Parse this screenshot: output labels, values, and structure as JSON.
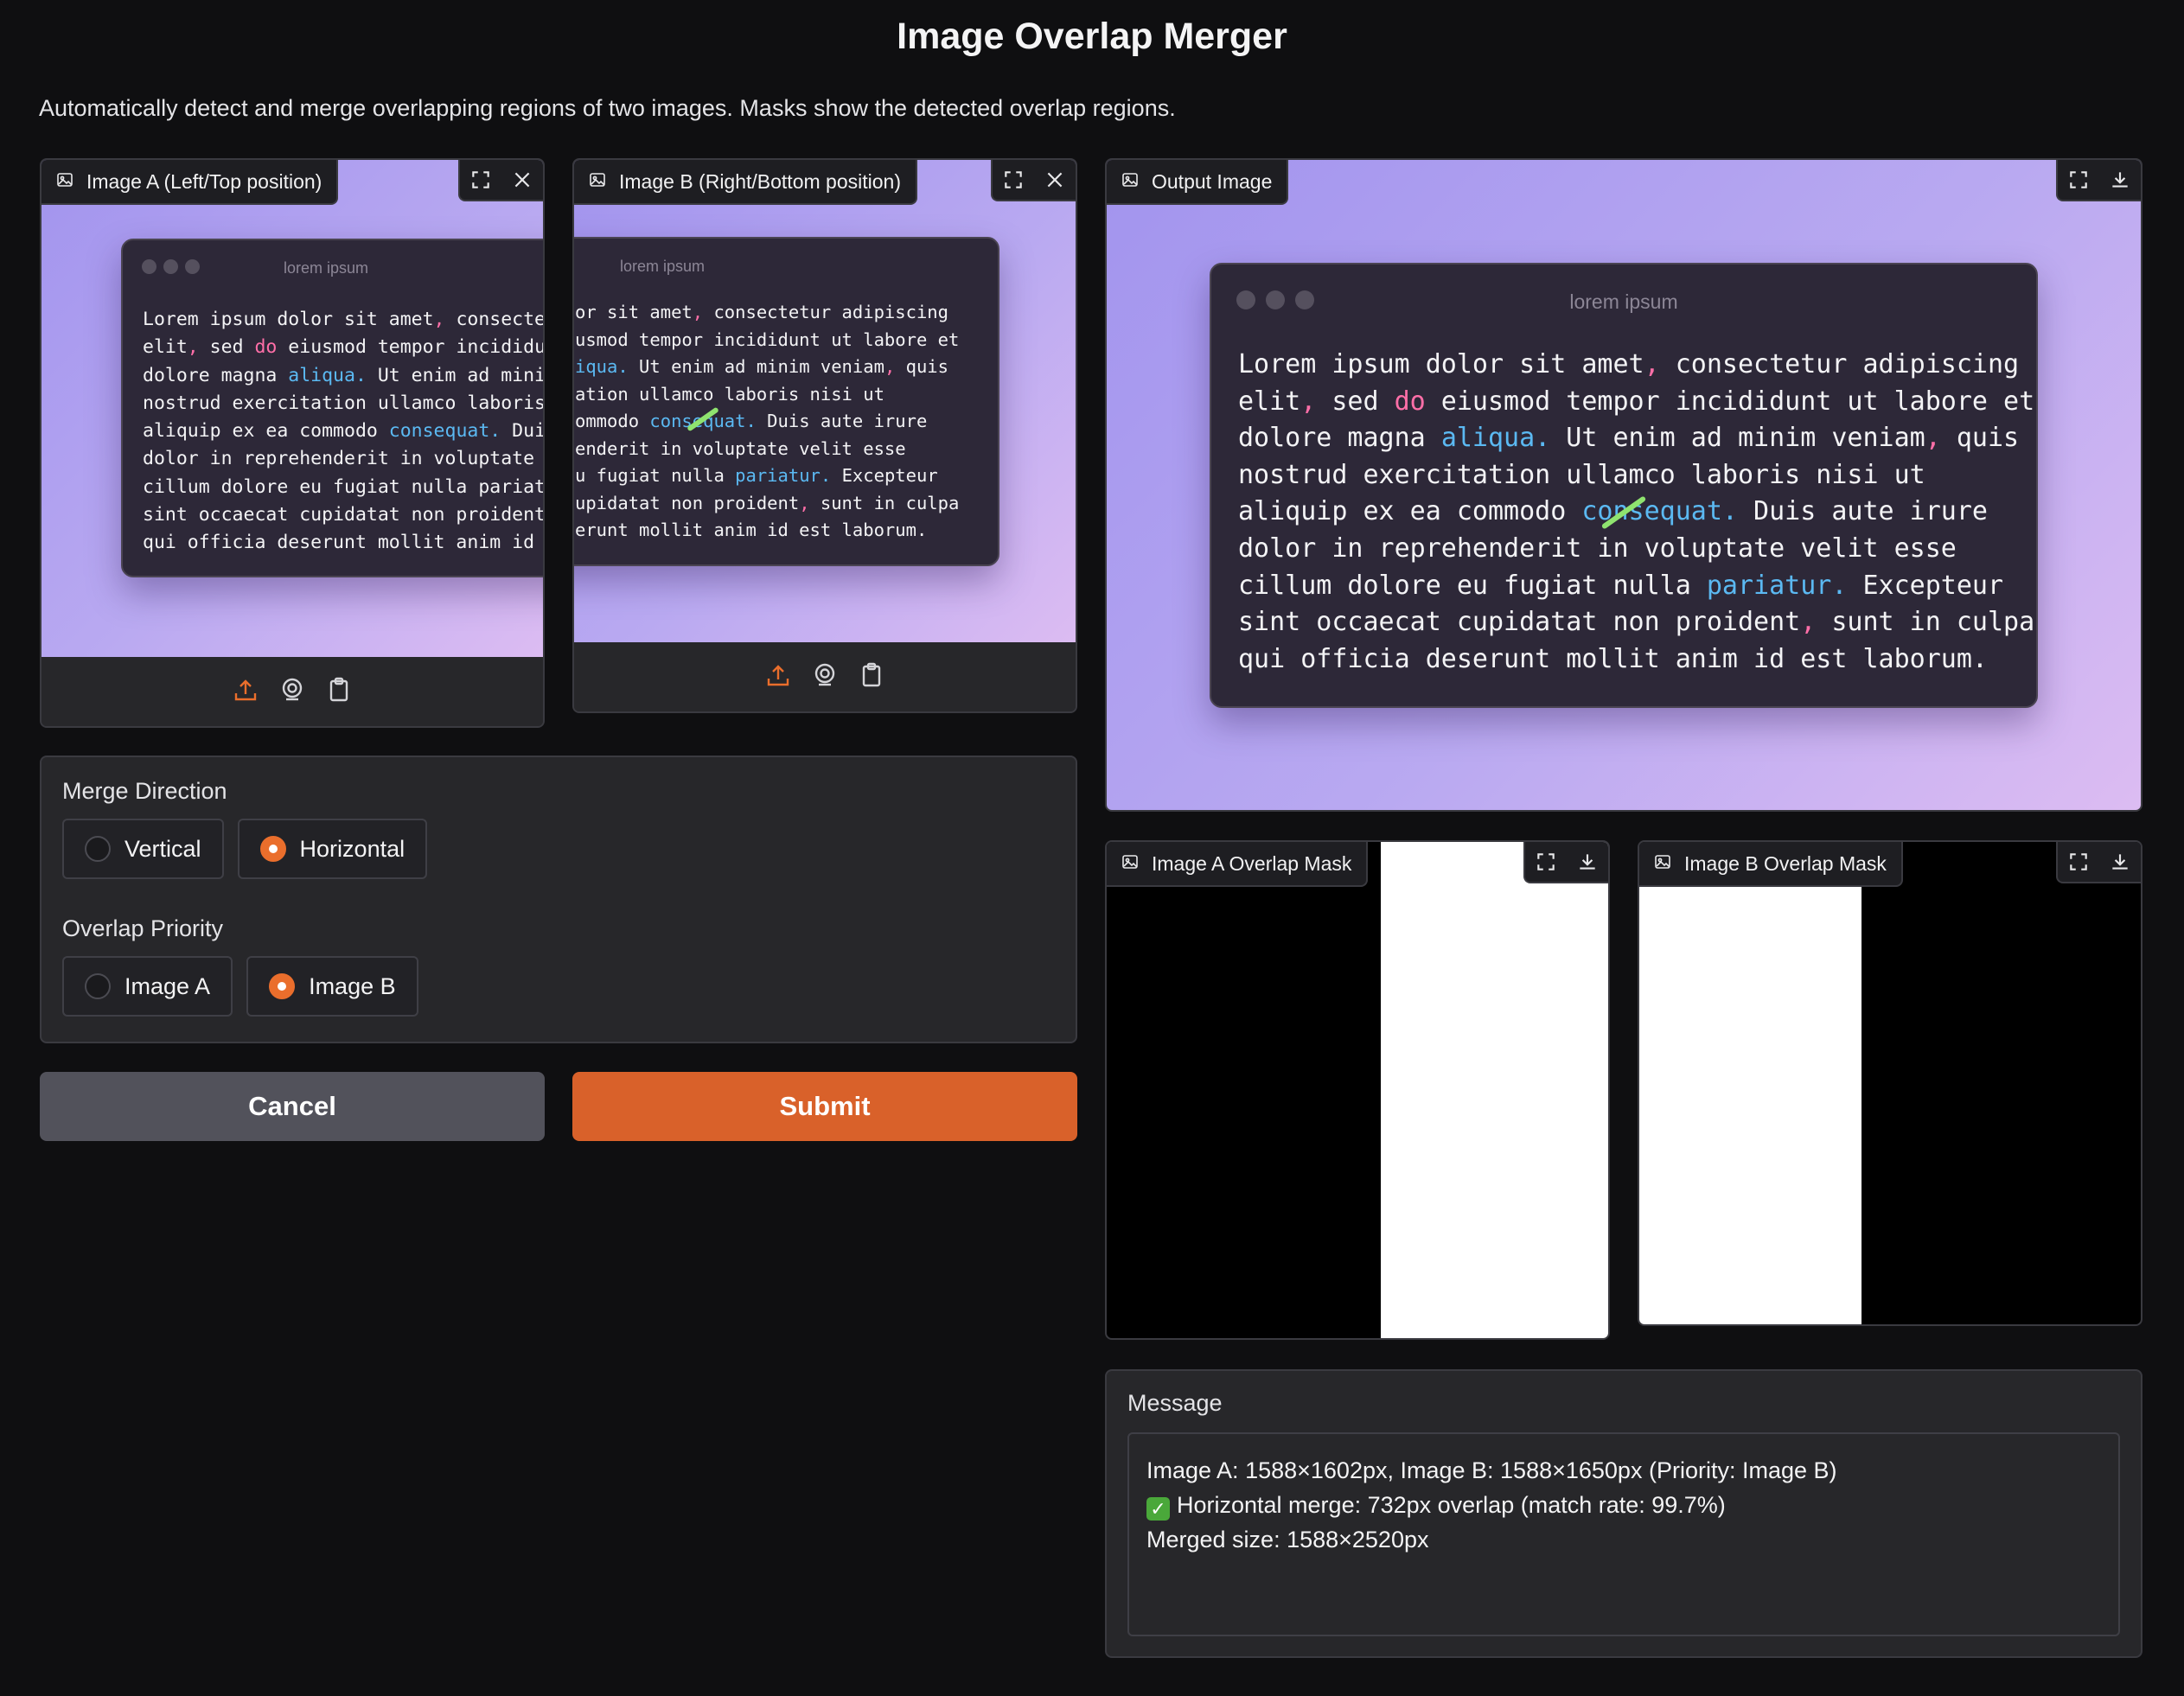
{
  "app": {
    "title": "Image Overlap Merger",
    "description": "Automatically detect and merge overlapping regions of two images. Masks show the detected overlap regions."
  },
  "image_a": {
    "label": "Image A (Left/Top position)"
  },
  "image_b": {
    "label": "Image B (Right/Bottom position)"
  },
  "output": {
    "label": "Output Image"
  },
  "mask_a": {
    "label": "Image A Overlap Mask",
    "white_fraction_start": 0.545
  },
  "mask_b": {
    "label": "Image B Overlap Mask",
    "white_fraction_end": 0.44
  },
  "sample_window": {
    "title": "lorem ipsum",
    "lines": [
      "Lorem ipsum dolor sit amet, consectetur adipiscing",
      "elit, sed do eiusmod tempor incididunt ut labore et",
      "dolore magna aliqua. Ut enim ad minim veniam, quis",
      "nostrud exercitation ullamco laboris nisi ut",
      "aliquip ex ea commodo consequat. Duis aute irure",
      "dolor in reprehenderit in voluptate velit esse",
      "cillum dolore eu fugiat nulla pariatur. Excepteur",
      "sint occaecat cupidatat non proident, sunt in culpa",
      "qui officia deserunt mollit anim id est laborum."
    ],
    "crop_a_lines": [
      "Lorem ipsum dolor sit amet, consecte",
      "elit, sed do eiusmod tempor incididu",
      "dolore magna aliqua. Ut enim ad mini",
      "nostrud exercitation ullamco laboris",
      "aliquip ex ea commodo consequat. Dui",
      "dolor in reprehenderit in voluptate ",
      "cillum dolore eu fugiat nulla pariat",
      "sint occaecat cupidatat non proident",
      "qui officia deserunt mollit anim id "
    ],
    "crop_b_lines": [
      "or sit amet, consectetur adipiscing",
      "usmod tempor incididunt ut labore et",
      "iqua. Ut enim ad minim veniam, quis",
      "ation ullamco laboris nisi ut",
      "ommodo consequat. Duis aute irure",
      "enderit in voluptate velit esse",
      "u fugiat nulla pariatur. Excepteur",
      "upidatat non proident, sunt in culpa",
      "erunt mollit anim id est laborum."
    ]
  },
  "merge_direction": {
    "label": "Merge Direction",
    "options": [
      "Vertical",
      "Horizontal"
    ],
    "selected": "Horizontal"
  },
  "overlap_priority": {
    "label": "Overlap Priority",
    "options": [
      "Image A",
      "Image B"
    ],
    "selected": "Image B"
  },
  "buttons": {
    "cancel": "Cancel",
    "submit": "Submit"
  },
  "message": {
    "label": "Message",
    "lines": [
      "Image A: 1588×1602px, Image B: 1588×1650px (Priority: Image B)",
      "Horizontal merge: 732px overlap (match rate: 99.7%)",
      "Merged size: 1588×2520px"
    ]
  },
  "colors": {
    "accent": "#ea6e2c",
    "submit": "#d9612a",
    "cancel": "#52525b"
  },
  "icons": {
    "label": "image-icon",
    "fullscreen": "fullscreen-icon",
    "close": "close-icon",
    "download": "download-icon",
    "upload": "upload-icon",
    "webcam": "webcam-icon",
    "clipboard": "clipboard-icon"
  }
}
